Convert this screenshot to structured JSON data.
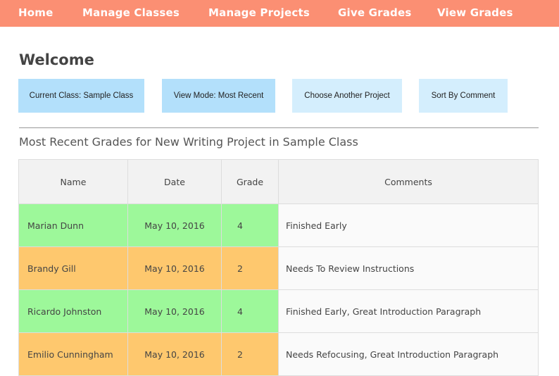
{
  "nav": {
    "items": [
      {
        "label": "Home"
      },
      {
        "label": "Manage Classes"
      },
      {
        "label": "Manage Projects"
      },
      {
        "label": "Give Grades"
      },
      {
        "label": "View Grades"
      }
    ]
  },
  "header": {
    "title": "Welcome"
  },
  "controls": {
    "current_class": "Current Class: Sample Class",
    "view_mode": "View Mode: Most Recent",
    "choose_project": "Choose Another Project",
    "sort_by": "Sort By Comment"
  },
  "section": {
    "title": "Most Recent Grades for New Writing Project in Sample Class"
  },
  "table": {
    "headers": {
      "name": "Name",
      "date": "Date",
      "grade": "Grade",
      "comments": "Comments"
    },
    "rows": [
      {
        "name": "Marian Dunn",
        "date": "May 10, 2016",
        "grade": "4",
        "comment": "Finished Early",
        "status": "green"
      },
      {
        "name": "Brandy Gill",
        "date": "May 10, 2016",
        "grade": "2",
        "comment": "Needs To Review Instructions",
        "status": "orange"
      },
      {
        "name": "Ricardo Johnston",
        "date": "May 10, 2016",
        "grade": "4",
        "comment": "Finished Early, Great Introduction Paragraph",
        "status": "green"
      },
      {
        "name": "Emilio Cunningham",
        "date": "May 10, 2016",
        "grade": "2",
        "comment": "Needs Refocusing, Great Introduction Paragraph",
        "status": "orange"
      }
    ]
  },
  "colors": {
    "nav_bg": "#fb8f73",
    "button_active": "#b3e0fb",
    "button_inactive": "#d4eefd",
    "grade_high": "#9df89a",
    "grade_low": "#fec86e"
  }
}
